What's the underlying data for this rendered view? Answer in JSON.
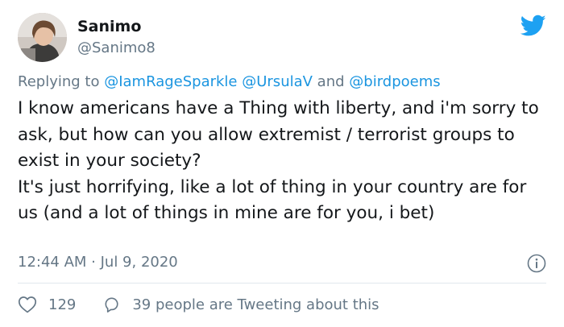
{
  "user": {
    "display_name": "Sanimo",
    "handle": "@Sanimo8"
  },
  "reply": {
    "prefix": "Replying to ",
    "mentions": [
      "@IamRageSparkle",
      "@UrsulaV",
      "@birdpoems"
    ],
    "separator_1": " ",
    "separator_2": " and "
  },
  "tweet": {
    "text": "I know americans have a Thing with liberty, and i'm sorry to ask, but how can you allow extremist / terrorist groups to exist in your society?\nIt's just horrifying, like a lot of thing in your country are for us (and a lot of things in mine are for you, i bet)",
    "timestamp": "12:44 AM · Jul 9, 2020"
  },
  "stats": {
    "likes": "129",
    "tweeting_about": "39 people are Tweeting about this"
  },
  "icons": {
    "brand": "twitter-bird-icon",
    "info": "info-icon",
    "like": "heart-icon",
    "reply": "speech-bubble-icon"
  },
  "colors": {
    "brand": "#1da1f2",
    "link": "#1b95e0",
    "text": "#14171a",
    "muted": "#657786",
    "divider": "#e1e8ed"
  }
}
